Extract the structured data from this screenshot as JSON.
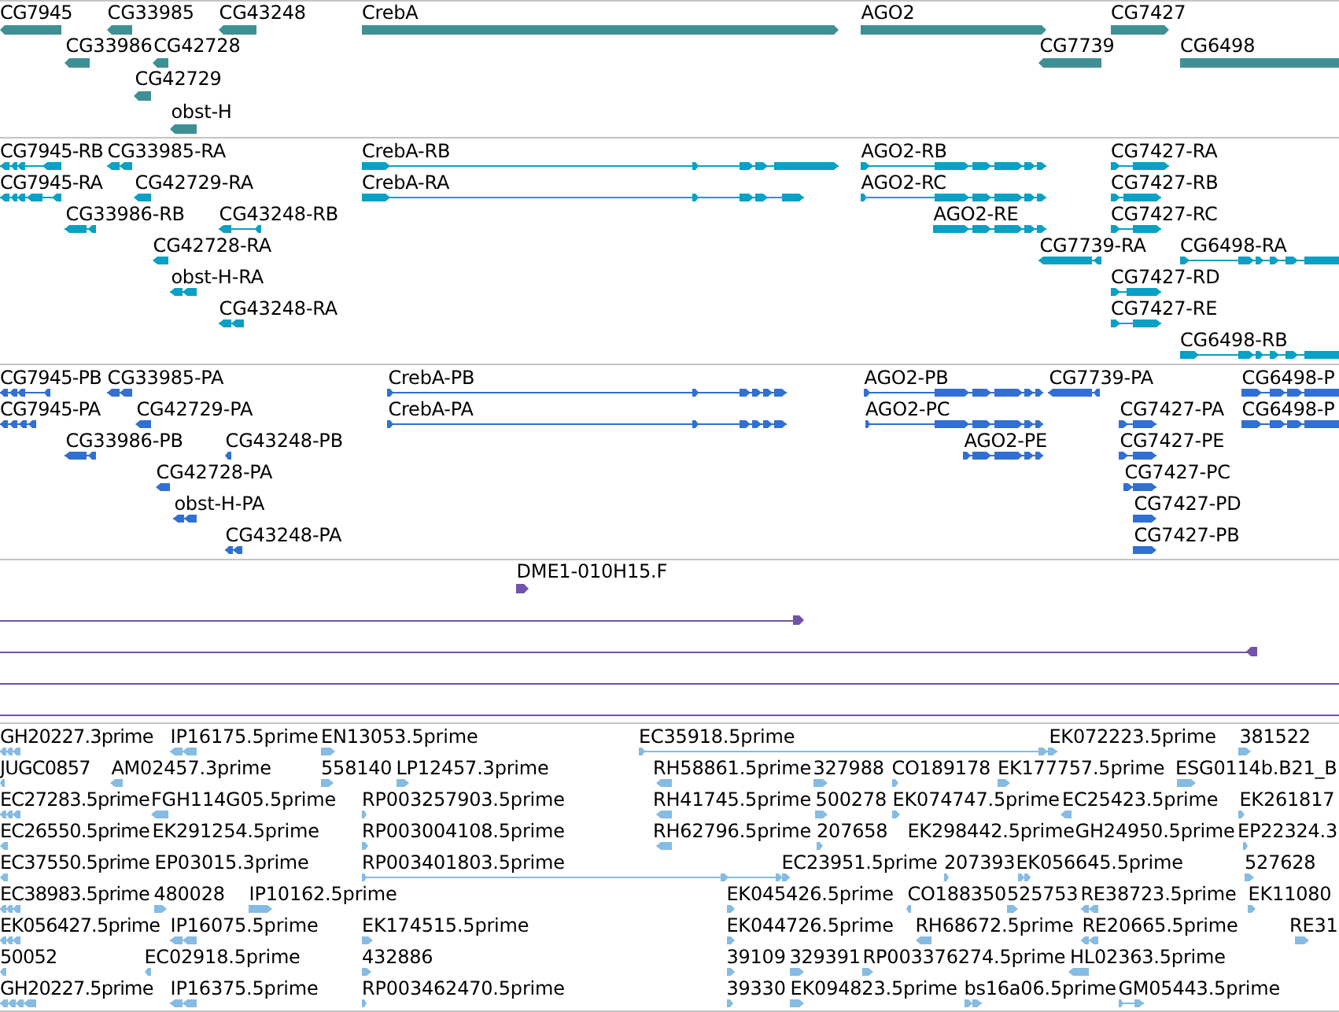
{
  "tracks": [
    {
      "kind": "gene",
      "features": [
        {
          "label": "CG7945",
          "reverse": true
        },
        {
          "label": "CG33985",
          "reverse": true
        },
        {
          "label": "CG43248",
          "reverse": true
        },
        {
          "label": "CrebA",
          "reverse": false
        },
        {
          "label": "AGO2",
          "reverse": false
        },
        {
          "label": "CG7427",
          "reverse": false
        },
        {
          "label": "CG33986",
          "reverse": true
        },
        {
          "label": "CG42728",
          "reverse": true
        },
        {
          "label": "CG7739",
          "reverse": true
        },
        {
          "label": "CG6498",
          "reverse": false
        },
        {
          "label": "CG42729",
          "reverse": true
        },
        {
          "label": "obst-H",
          "reverse": true
        }
      ]
    },
    {
      "kind": "transcript",
      "features": [
        {
          "label": "CG7945-RB",
          "reverse": true
        },
        {
          "label": "CG33985-RA",
          "reverse": true
        },
        {
          "label": "CrebA-RB",
          "reverse": false
        },
        {
          "label": "AGO2-RB",
          "reverse": false
        },
        {
          "label": "CG7427-RA",
          "reverse": false
        },
        {
          "label": "CG7945-RA",
          "reverse": true
        },
        {
          "label": "CG42729-RA",
          "reverse": true
        },
        {
          "label": "CrebA-RA",
          "reverse": false
        },
        {
          "label": "AGO2-RC",
          "reverse": false
        },
        {
          "label": "CG7427-RB",
          "reverse": false
        },
        {
          "label": "CG33986-RB",
          "reverse": true
        },
        {
          "label": "CG43248-RB",
          "reverse": true
        },
        {
          "label": "AGO2-RE",
          "reverse": false
        },
        {
          "label": "CG7427-RC",
          "reverse": false
        },
        {
          "label": "CG42728-RA",
          "reverse": true
        },
        {
          "label": "CG7739-RA",
          "reverse": true
        },
        {
          "label": "CG6498-RA",
          "reverse": false
        },
        {
          "label": "obst-H-RA",
          "reverse": true
        },
        {
          "label": "CG7427-RD",
          "reverse": false
        },
        {
          "label": "CG43248-RA",
          "reverse": true
        },
        {
          "label": "CG7427-RE",
          "reverse": false
        },
        {
          "label": "CG6498-RB",
          "reverse": false
        }
      ]
    },
    {
      "kind": "protein",
      "features": [
        {
          "label": "CG7945-PB",
          "reverse": true
        },
        {
          "label": "CG33985-PA",
          "reverse": true
        },
        {
          "label": "CrebA-PB",
          "reverse": false
        },
        {
          "label": "AGO2-PB",
          "reverse": false
        },
        {
          "label": "CG7739-PA",
          "reverse": true
        },
        {
          "label": "CG6498-P",
          "reverse": false
        },
        {
          "label": "CG7945-PA",
          "reverse": true
        },
        {
          "label": "CG42729-PA",
          "reverse": true
        },
        {
          "label": "CrebA-PA",
          "reverse": false
        },
        {
          "label": "AGO2-PC",
          "reverse": false
        },
        {
          "label": "CG7427-PA",
          "reverse": false
        },
        {
          "label": "CG6498-P",
          "reverse": false
        },
        {
          "label": "CG33986-PB",
          "reverse": true
        },
        {
          "label": "CG43248-PB",
          "reverse": true
        },
        {
          "label": "AGO2-PE",
          "reverse": false
        },
        {
          "label": "CG7427-PE",
          "reverse": false
        },
        {
          "label": "CG42728-PA",
          "reverse": true
        },
        {
          "label": "CG7427-PC",
          "reverse": false
        },
        {
          "label": "obst-H-PA",
          "reverse": true
        },
        {
          "label": "CG7427-PD",
          "reverse": false
        },
        {
          "label": "CG43248-PA",
          "reverse": true
        },
        {
          "label": "CG7427-PB",
          "reverse": false
        }
      ]
    },
    {
      "kind": "clone",
      "features": [
        {
          "label": "DME1-010H15.F",
          "reverse": false
        }
      ]
    },
    {
      "kind": "est",
      "features": [
        {
          "label": "GH20227.3prime",
          "reverse": true
        },
        {
          "label": "IP16175.5prime",
          "reverse": true
        },
        {
          "label": "EN13053.5prime",
          "reverse": false
        },
        {
          "label": "EC35918.5prime",
          "reverse": false
        },
        {
          "label": "EK072223.5prime"
        },
        {
          "label": "381522",
          "reverse": false
        },
        {
          "label": "JUGC0857",
          "reverse": true
        },
        {
          "label": "AM02457.3prime",
          "reverse": true
        },
        {
          "label": "558140",
          "reverse": false
        },
        {
          "label": "LP12457.3prime",
          "reverse": false
        },
        {
          "label": "RH58861.5prime",
          "reverse": true
        },
        {
          "label": "327988",
          "reverse": false
        },
        {
          "label": "CO189178",
          "reverse": false
        },
        {
          "label": "EK177757.5prime",
          "reverse": false
        },
        {
          "label": "ESG0114b.B21_B",
          "reverse": false
        },
        {
          "label": "EC27283.5prime",
          "reverse": true
        },
        {
          "label": "FGH114G05.5prime",
          "reverse": true
        },
        {
          "label": "RP003257903.5prime",
          "reverse": false
        },
        {
          "label": "RH41745.5prime",
          "reverse": true
        },
        {
          "label": "500278",
          "reverse": false
        },
        {
          "label": "EK074747.5prime",
          "reverse": false
        },
        {
          "label": "EC25423.5prime",
          "reverse": true
        },
        {
          "label": "EK261817",
          "reverse": false
        },
        {
          "label": "EC26550.5prime",
          "reverse": true
        },
        {
          "label": "EK291254.5prime"
        },
        {
          "label": "RP003004108.5prime",
          "reverse": false
        },
        {
          "label": "RH62796.5prime",
          "reverse": true
        },
        {
          "label": "207658",
          "reverse": false
        },
        {
          "label": "EK298442.5prime"
        },
        {
          "label": "GH24950.5prime"
        },
        {
          "label": "EP22324.3",
          "reverse": false
        },
        {
          "label": "EC37550.5prime",
          "reverse": true
        },
        {
          "label": "EP03015.3prime"
        },
        {
          "label": "RP003401803.5prime",
          "reverse": false
        },
        {
          "label": "EC23951.5prime"
        },
        {
          "label": "207393",
          "reverse": false
        },
        {
          "label": "EK056645.5prime",
          "reverse": false
        },
        {
          "label": "527628",
          "reverse": false
        },
        {
          "label": "EC38983.5prime",
          "reverse": true
        },
        {
          "label": "480028",
          "reverse": false
        },
        {
          "label": "IP10162.5prime",
          "reverse": false
        },
        {
          "label": "EK045426.5prime",
          "reverse": false
        },
        {
          "label": "CO188350",
          "reverse": true
        },
        {
          "label": "525753",
          "reverse": false
        },
        {
          "label": "RE38723.5prime",
          "reverse": true
        },
        {
          "label": "EK11080",
          "reverse": false
        },
        {
          "label": "EK056427.5prime",
          "reverse": true
        },
        {
          "label": "IP16075.5prime",
          "reverse": true
        },
        {
          "label": "EK174515.5prime",
          "reverse": false
        },
        {
          "label": "EK044726.5prime",
          "reverse": false
        },
        {
          "label": "RH68672.5prime",
          "reverse": true
        },
        {
          "label": "RE20665.5prime",
          "reverse": true
        },
        {
          "label": "RE31",
          "reverse": false
        },
        {
          "label": "50052",
          "reverse": true
        },
        {
          "label": "EC02918.5prime",
          "reverse": true
        },
        {
          "label": "432886",
          "reverse": false
        },
        {
          "label": "39109",
          "reverse": false
        },
        {
          "label": "329391",
          "reverse": false
        },
        {
          "label": "RP003376274.5prime",
          "reverse": false
        },
        {
          "label": "HL02363.5prime",
          "reverse": true
        },
        {
          "label": "GH20227.5prime",
          "reverse": true
        },
        {
          "label": "IP16375.5prime",
          "reverse": true
        },
        {
          "label": "RP003462470.5prime",
          "reverse": false
        },
        {
          "label": "39330",
          "reverse": false
        },
        {
          "label": "EK094823.5prime",
          "reverse": false
        },
        {
          "label": "bs16a06.5prime",
          "reverse": false
        },
        {
          "label": "GM05443.5prime",
          "reverse": false
        }
      ]
    }
  ]
}
